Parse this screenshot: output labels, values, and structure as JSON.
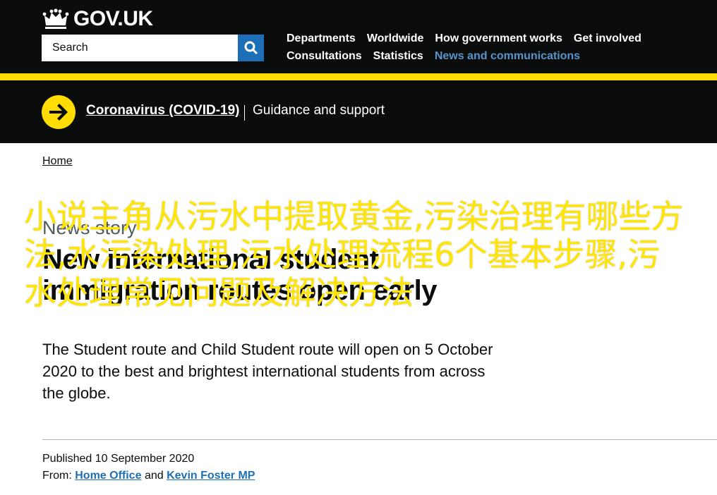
{
  "header": {
    "logo_text": "GOV.UK",
    "logo_icon": "crown-icon",
    "search": {
      "placeholder": "Search",
      "button_icon": "search-icon"
    },
    "nav": [
      {
        "label": "Departments",
        "active": false
      },
      {
        "label": "Worldwide",
        "active": false
      },
      {
        "label": "How government works",
        "active": false
      },
      {
        "label": "Get involved",
        "active": false
      },
      {
        "label": "Consultations",
        "active": false
      },
      {
        "label": "Statistics",
        "active": false
      },
      {
        "label": "News and communications",
        "active": true
      }
    ]
  },
  "covid_banner": {
    "icon": "arrow-right-circle-icon",
    "link": "Coronavirus (COVID-19)",
    "subtitle": "Guidance and support"
  },
  "breadcrumb": {
    "home": "Home"
  },
  "article": {
    "caption": "News story",
    "title": "New international student immigration routes open early",
    "lead": "The Student route and Child Student route will open on 5 October 2020 to the best and brightest international students from across the globe.",
    "published": "Published 10 September 2020",
    "from_label": "From:",
    "from_links": [
      "Home Office",
      "Kevin Foster MP"
    ],
    "from_and": "and"
  },
  "watermark": {
    "text": "小说主角从污水中提取黄金,污染治理有哪些方法,水污染处理,污水处理流程6个基本步骤,污水处理常见问题及解决方法"
  },
  "colors": {
    "header_bg": "#0b0c0c",
    "accent_yellow": "#ffdd00",
    "link_blue": "#1d70b8",
    "active_nav": "#5694ca",
    "watermark": "#ffe600"
  }
}
